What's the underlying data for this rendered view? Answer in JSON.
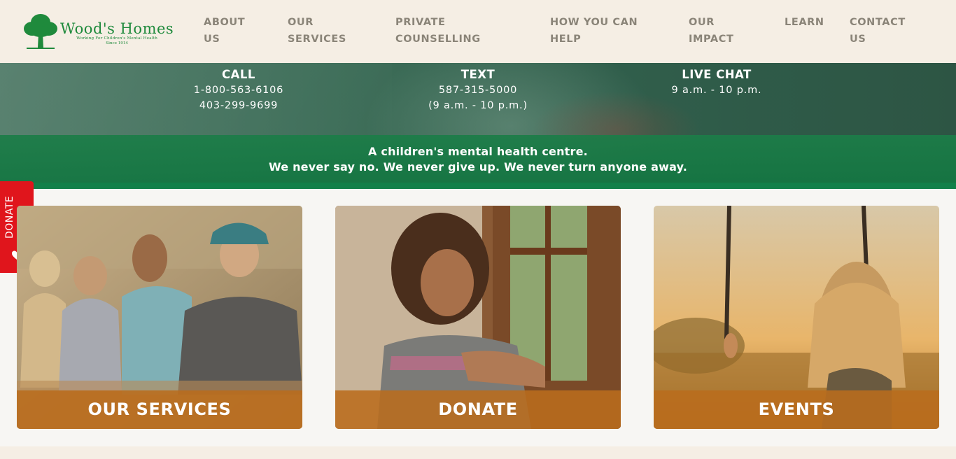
{
  "brand": {
    "name": "Wood's Homes",
    "tagline": "Working For Children's Mental Health",
    "since": "Since 1914",
    "color": "#1f8a3c"
  },
  "nav": [
    {
      "line1": "ABOUT",
      "line2": "US"
    },
    {
      "line1": "OUR",
      "line2": "SERVICES"
    },
    {
      "line1": "PRIVATE",
      "line2": "COUNSELLING"
    },
    {
      "line1": "HOW YOU CAN",
      "line2": "HELP"
    },
    {
      "line1": "OUR",
      "line2": "IMPACT"
    },
    {
      "line1": "LEARN",
      "line2": ""
    },
    {
      "line1": "CONTACT",
      "line2": "US"
    }
  ],
  "contact": {
    "call": {
      "label": "CALL",
      "line1": "1-800-563-6106",
      "line2": "403-299-9699"
    },
    "text": {
      "label": "TEXT",
      "line1": "587-315-5000",
      "line2": "(9 a.m. - 10 p.m.)"
    },
    "chat": {
      "label": "LIVE CHAT",
      "line1": "9 a.m. - 10 p.m."
    }
  },
  "tagline": {
    "line1": "A children's mental health centre.",
    "line2": "We never say no. We never give up. We never turn anyone away."
  },
  "donate_tab": {
    "label": "DONATE",
    "icon": "heart-icon",
    "color": "#e0151c"
  },
  "cards": [
    {
      "label": "OUR SERVICES"
    },
    {
      "label": "DONATE"
    },
    {
      "label": "EVENTS"
    }
  ],
  "colors": {
    "accent_green": "#1c7d48",
    "card_label_orange": "#ba6c1c",
    "header_bg": "#f5eee4"
  }
}
